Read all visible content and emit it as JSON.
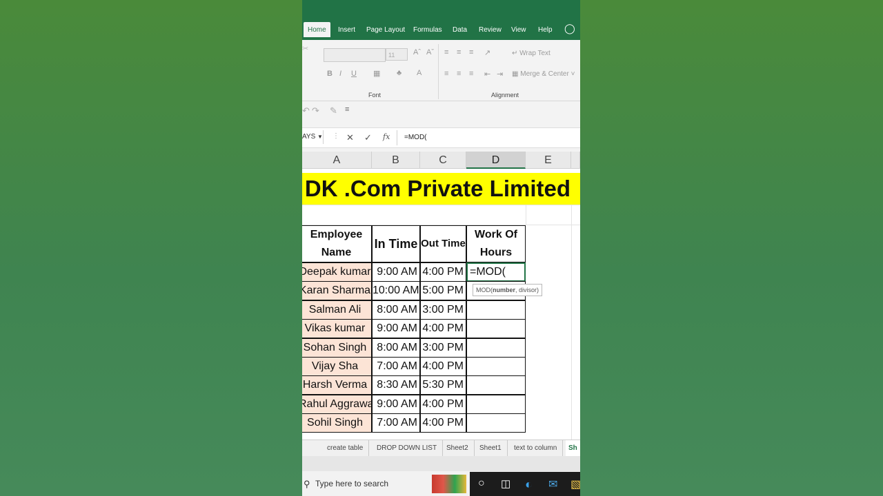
{
  "ribbon": {
    "tabs": [
      "Home",
      "Insert",
      "Page Layout",
      "Formulas",
      "Data",
      "Review",
      "View",
      "Help"
    ],
    "font_size": "11",
    "bold": "B",
    "italic": "I",
    "underline": "U",
    "wrap_text": "Wrap Text",
    "merge_center": "Merge & Center",
    "group_font": "Font",
    "group_alignment": "Alignment"
  },
  "formula_bar": {
    "name_box": "AYS",
    "cancel": "✕",
    "enter": "✓",
    "fx": "fx",
    "formula": "=MOD("
  },
  "columns": [
    "A",
    "B",
    "C",
    "D",
    "E"
  ],
  "banner": "DK .Com Private Limited",
  "table": {
    "headers": [
      "Employee Name",
      "In Time",
      "Out Time",
      "Work Of Hours"
    ],
    "rows": [
      {
        "name": "Deepak kumar",
        "in": "9:00 AM",
        "out": "4:00 PM",
        "hours": "=MOD("
      },
      {
        "name": "Karan Sharma",
        "in": "10:00 AM",
        "out": "5:00 PM",
        "hours": ""
      },
      {
        "name": "Salman Ali",
        "in": "8:00 AM",
        "out": "3:00 PM",
        "hours": ""
      },
      {
        "name": "Vikas kumar",
        "in": "9:00 AM",
        "out": "4:00 PM",
        "hours": ""
      },
      {
        "name": "Sohan Singh",
        "in": "8:00 AM",
        "out": "3:00 PM",
        "hours": ""
      },
      {
        "name": "Vijay Sha",
        "in": "7:00 AM",
        "out": "4:00 PM",
        "hours": ""
      },
      {
        "name": "Harsh Verma",
        "in": "8:30 AM",
        "out": "5:30 PM",
        "hours": ""
      },
      {
        "name": "Rahul Aggrawal",
        "in": "9:00 AM",
        "out": "4:00 PM",
        "hours": ""
      },
      {
        "name": "Sohil Singh",
        "in": "7:00 AM",
        "out": "4:00 PM",
        "hours": ""
      }
    ]
  },
  "tooltip": {
    "fn": "MOD(",
    "arg1": "number",
    "rest": ", divisor)"
  },
  "sheet_tabs": [
    "create table",
    "DROP DOWN LIST",
    "Sheet2",
    "Sheet1",
    "text to column",
    "Sh"
  ],
  "taskbar": {
    "search_placeholder": "Type here to search"
  },
  "colors": {
    "excel_green": "#217346",
    "banner_yellow": "#ffff00",
    "name_fill": "#fce4d6"
  }
}
